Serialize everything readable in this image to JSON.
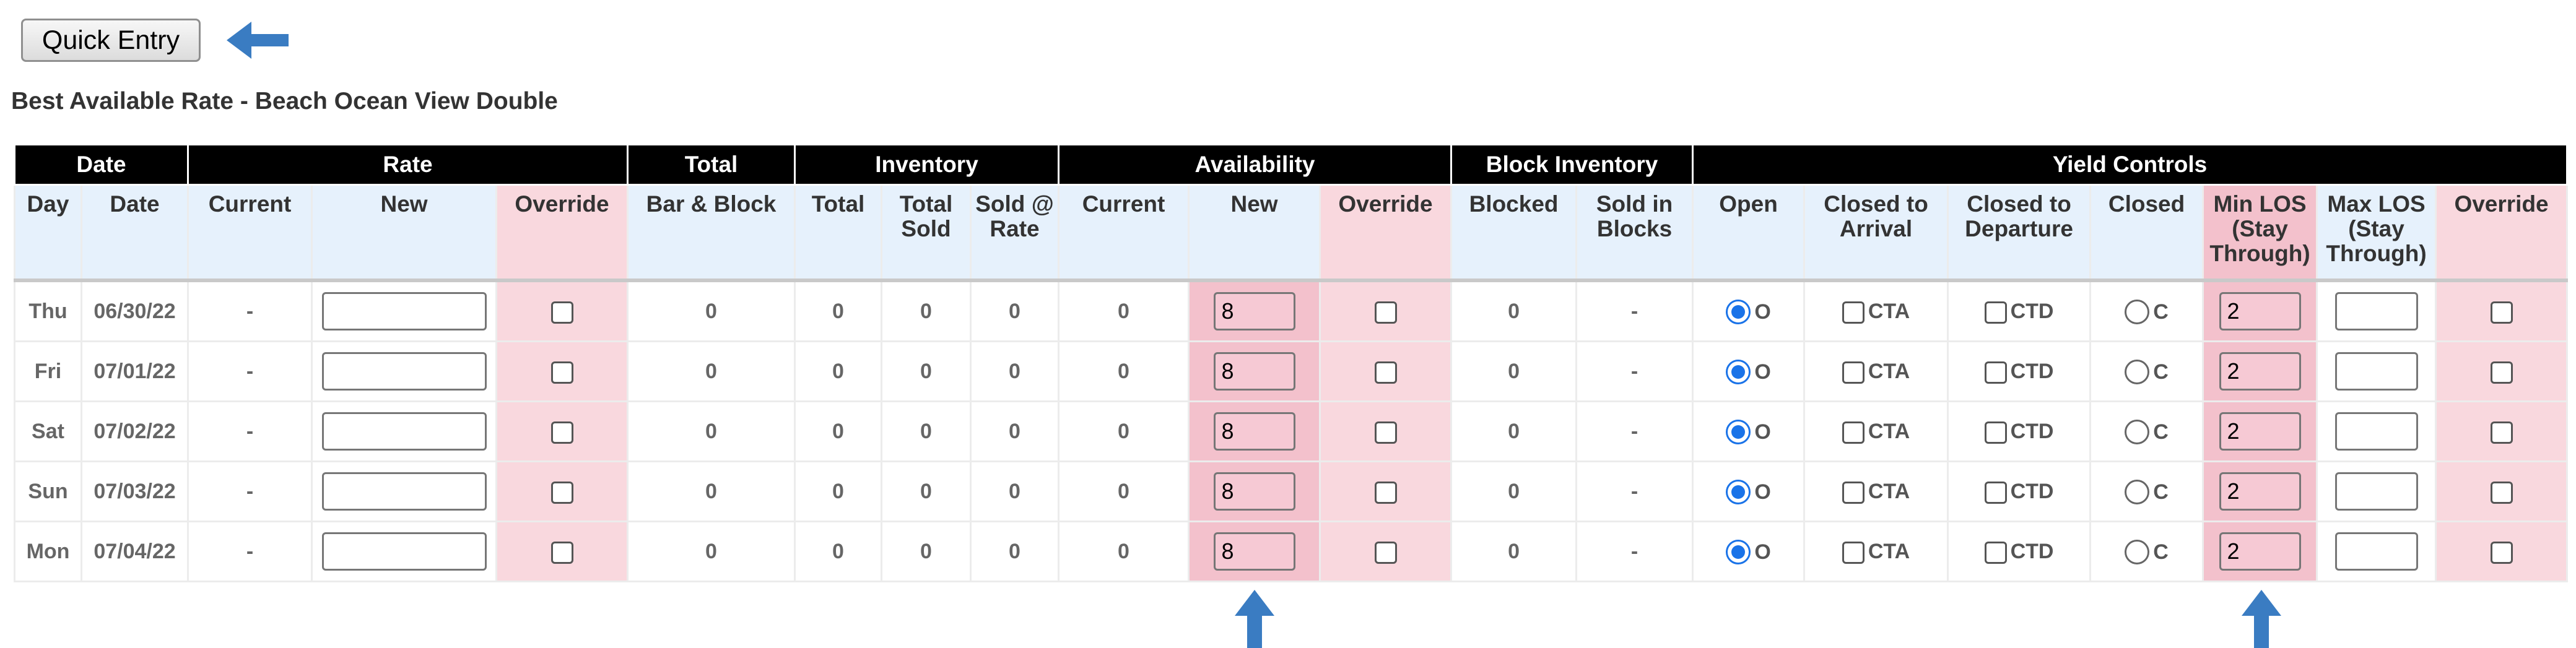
{
  "toolbar": {
    "quick_entry_label": "Quick Entry"
  },
  "subtitle": "Best Available Rate - Beach Ocean View Double",
  "groups": {
    "date": "Date",
    "rate": "Rate",
    "total": "Total",
    "inventory": "Inventory",
    "availability": "Availability",
    "block_inventory": "Block Inventory",
    "yield_controls": "Yield Controls"
  },
  "columns": {
    "day": "Day",
    "date": "Date",
    "rate_current": "Current",
    "rate_new": "New",
    "rate_override": "Override",
    "bar_block": "Bar & Block",
    "inv_total": "Total",
    "inv_total_sold": "Total Sold",
    "inv_sold_rate": "Sold @ Rate",
    "avail_current": "Current",
    "avail_new": "New",
    "avail_override": "Override",
    "blocked": "Blocked",
    "sold_in_blocks": "Sold in Blocks",
    "open": "Open",
    "closed_arrival": "Closed to Arrival",
    "closed_departure": "Closed to Departure",
    "closed": "Closed",
    "min_los": "Min LOS (Stay Through)",
    "max_los": "Max LOS (Stay Through)",
    "yield_override": "Override"
  },
  "option_labels": {
    "open": "O",
    "cta": "CTA",
    "ctd": "CTD",
    "closed": "C"
  },
  "rows": [
    {
      "day": "Thu",
      "date": "06/30/22",
      "rate_current": "-",
      "rate_new": "",
      "bar_block": "0",
      "inv_total": "0",
      "inv_total_sold": "0",
      "inv_sold_rate": "0",
      "avail_current": "0",
      "avail_new": "8",
      "blocked": "0",
      "sold_in_blocks": "-",
      "min_los": "2",
      "max_los": ""
    },
    {
      "day": "Fri",
      "date": "07/01/22",
      "rate_current": "-",
      "rate_new": "",
      "bar_block": "0",
      "inv_total": "0",
      "inv_total_sold": "0",
      "inv_sold_rate": "0",
      "avail_current": "0",
      "avail_new": "8",
      "blocked": "0",
      "sold_in_blocks": "-",
      "min_los": "2",
      "max_los": ""
    },
    {
      "day": "Sat",
      "date": "07/02/22",
      "rate_current": "-",
      "rate_new": "",
      "bar_block": "0",
      "inv_total": "0",
      "inv_total_sold": "0",
      "inv_sold_rate": "0",
      "avail_current": "0",
      "avail_new": "8",
      "blocked": "0",
      "sold_in_blocks": "-",
      "min_los": "2",
      "max_los": ""
    },
    {
      "day": "Sun",
      "date": "07/03/22",
      "rate_current": "-",
      "rate_new": "",
      "bar_block": "0",
      "inv_total": "0",
      "inv_total_sold": "0",
      "inv_sold_rate": "0",
      "avail_current": "0",
      "avail_new": "8",
      "blocked": "0",
      "sold_in_blocks": "-",
      "min_los": "2",
      "max_los": ""
    },
    {
      "day": "Mon",
      "date": "07/04/22",
      "rate_current": "-",
      "rate_new": "",
      "bar_block": "0",
      "inv_total": "0",
      "inv_total_sold": "0",
      "inv_sold_rate": "0",
      "avail_current": "0",
      "avail_new": "8",
      "blocked": "0",
      "sold_in_blocks": "-",
      "min_los": "2",
      "max_los": ""
    }
  ],
  "colors": {
    "header_black": "#000000",
    "header_blue": "#e6f1fc",
    "override_pink": "#f9d8de",
    "highlight_pink": "#f3c1cc",
    "arrow_blue": "#3a7cc2",
    "radio_blue": "#1a73e8"
  },
  "icons": {
    "left_arrow": "arrow-left-icon",
    "up_arrow": "arrow-up-icon"
  }
}
